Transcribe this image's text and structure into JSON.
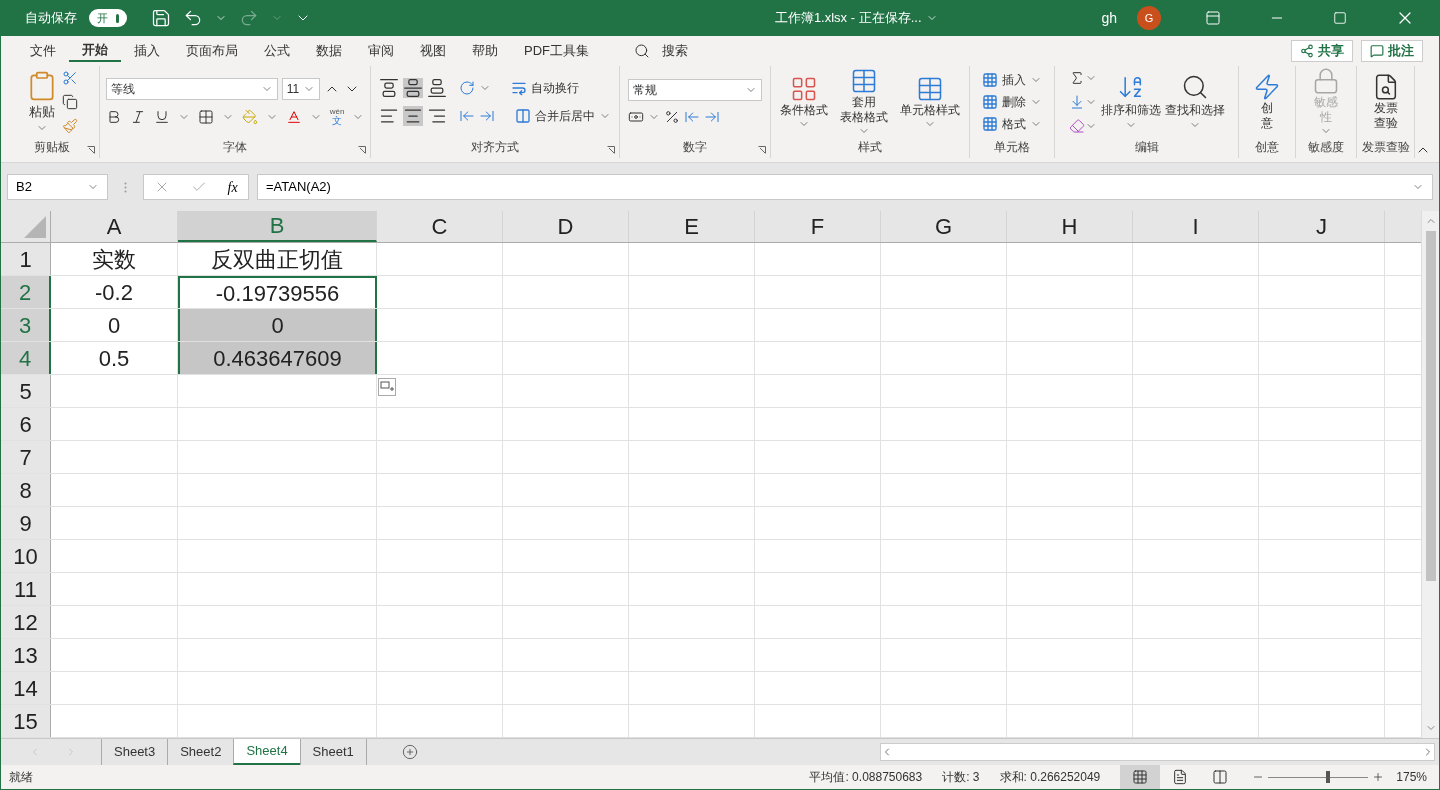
{
  "title_bar": {
    "autosave_label": "自动保存",
    "autosave_toggle": {
      "label": "开",
      "on": true
    },
    "title": "工作簿1.xlsx - 正在保存...",
    "user": "gh",
    "avatar": "G"
  },
  "menu_tabs": [
    {
      "label": "文件",
      "selected": false
    },
    {
      "label": "开始",
      "selected": true
    },
    {
      "label": "插入",
      "selected": false
    },
    {
      "label": "页面布局",
      "selected": false
    },
    {
      "label": "公式",
      "selected": false
    },
    {
      "label": "数据",
      "selected": false
    },
    {
      "label": "审阅",
      "selected": false
    },
    {
      "label": "视图",
      "selected": false
    },
    {
      "label": "帮助",
      "selected": false
    },
    {
      "label": "PDF工具集",
      "selected": false
    }
  ],
  "search": {
    "label": "搜索"
  },
  "actions": [
    "共享",
    "批注"
  ],
  "ribbon": {
    "clipboard": {
      "paste": "粘贴",
      "label": "剪贴板"
    },
    "font": {
      "name": "等线",
      "size": "11",
      "phonetic_top": "wén",
      "phonetic_bottom": "文",
      "label": "字体"
    },
    "alignment": {
      "wrap": "自动换行",
      "merge": "合并后居中",
      "label": "对齐方式"
    },
    "number": {
      "format": "常规",
      "label": "数字"
    },
    "styles": {
      "buttons": [
        {
          "lines": [
            "条件格式"
          ]
        },
        {
          "lines": [
            "套用",
            "表格格式"
          ]
        },
        {
          "lines": [
            "单元格样式"
          ]
        }
      ],
      "label": "样式"
    },
    "cells": {
      "buttons": [
        "插入",
        "删除",
        "格式"
      ],
      "label": "单元格"
    },
    "editing": {
      "buttons": [
        "排序和筛选",
        "查找和选择"
      ],
      "label": "编辑"
    },
    "extra": [
      {
        "lines": [
          "创",
          "意"
        ],
        "label": "创意",
        "disabled": false
      },
      {
        "lines": [
          "敏感",
          "性"
        ],
        "label": "敏感度",
        "disabled": true
      },
      {
        "lines": [
          "发票",
          "查验"
        ],
        "label": "发票查验",
        "disabled": false
      }
    ]
  },
  "formula_bar": {
    "name_box": "B2",
    "function_label": "fx",
    "formula": "=ATAN(A2)"
  },
  "columns": [
    {
      "label": "A",
      "selected": false
    },
    {
      "label": "B",
      "selected": true
    },
    {
      "label": "C",
      "selected": false
    },
    {
      "label": "D",
      "selected": false
    },
    {
      "label": "E",
      "selected": false
    },
    {
      "label": "F",
      "selected": false
    },
    {
      "label": "G",
      "selected": false
    },
    {
      "label": "H",
      "selected": false
    },
    {
      "label": "I",
      "selected": false
    },
    {
      "label": "J",
      "selected": false
    }
  ],
  "rows": [
    {
      "header": "1",
      "selected": false,
      "cells": [
        {
          "text": "实数",
          "selected": false,
          "active": false
        },
        {
          "text": "反双曲正切值",
          "selected": false,
          "active": false
        }
      ]
    },
    {
      "header": "2",
      "selected": true,
      "cells": [
        {
          "text": "-0.2",
          "selected": false,
          "active": false
        },
        {
          "text": "-0.19739556",
          "selected": true,
          "active": true
        }
      ]
    },
    {
      "header": "3",
      "selected": true,
      "cells": [
        {
          "text": "0",
          "selected": false,
          "active": false
        },
        {
          "text": "0",
          "selected": true,
          "active": false
        }
      ]
    },
    {
      "header": "4",
      "selected": true,
      "cells": [
        {
          "text": "0.5",
          "selected": false,
          "active": false
        },
        {
          "text": "0.463647609",
          "selected": true,
          "active": false
        }
      ]
    },
    {
      "header": "5",
      "selected": false,
      "cells": []
    },
    {
      "header": "6",
      "selected": false,
      "cells": []
    },
    {
      "header": "7",
      "selected": false,
      "cells": []
    },
    {
      "header": "8",
      "selected": false,
      "cells": []
    },
    {
      "header": "9",
      "selected": false,
      "cells": []
    },
    {
      "header": "10",
      "selected": false,
      "cells": []
    },
    {
      "header": "11",
      "selected": false,
      "cells": []
    },
    {
      "header": "12",
      "selected": false,
      "cells": []
    },
    {
      "header": "13",
      "selected": false,
      "cells": []
    },
    {
      "header": "14",
      "selected": false,
      "cells": []
    },
    {
      "header": "15",
      "selected": false,
      "cells": []
    }
  ],
  "sheet_tabs": [
    {
      "label": "Sheet3",
      "selected": false
    },
    {
      "label": "Sheet2",
      "selected": false
    },
    {
      "label": "Sheet4",
      "selected": true
    },
    {
      "label": "Sheet1",
      "selected": false
    }
  ],
  "status_bar": {
    "status": "就绪",
    "average": "平均值: 0.088750683",
    "count": "计数: 3",
    "sum": "求和: 0.266252049",
    "views": [
      {
        "kind": "normal",
        "selected": true
      },
      {
        "kind": "page_layout",
        "selected": false
      },
      {
        "kind": "page_break",
        "selected": false
      }
    ],
    "zoom": "175%",
    "zoom_slider": {
      "level": 0.6
    }
  }
}
